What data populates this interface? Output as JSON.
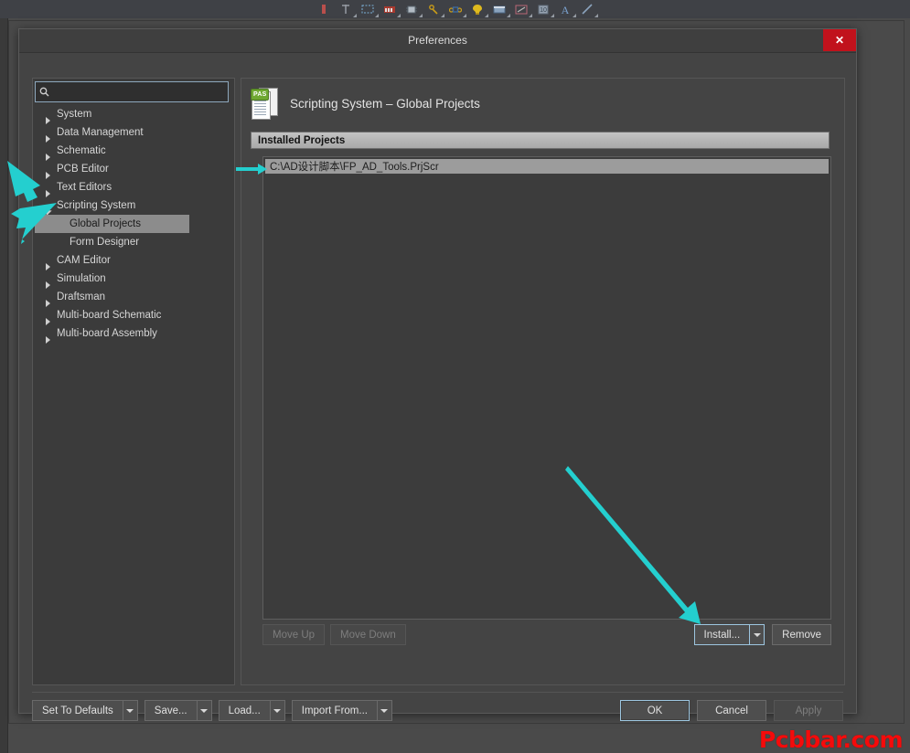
{
  "app": {
    "toolbar_icons": [
      "component-icon",
      "place-wire-icon",
      "rectangle-select-icon",
      "board-icon",
      "chip-icon",
      "tools-icon",
      "net-icon",
      "lamp-icon",
      "panel-icon",
      "draw-icon",
      "image-icon",
      "text-icon",
      "line-icon"
    ]
  },
  "dialog": {
    "title": "Preferences",
    "close_label": "✕"
  },
  "search": {
    "value": "",
    "placeholder": "",
    "icon": "search-icon"
  },
  "sidebar": {
    "items": [
      {
        "label": "System",
        "level": 0,
        "state": "collapsed",
        "selected": false
      },
      {
        "label": "Data Management",
        "level": 0,
        "state": "collapsed",
        "selected": false
      },
      {
        "label": "Schematic",
        "level": 0,
        "state": "collapsed",
        "selected": false
      },
      {
        "label": "PCB Editor",
        "level": 0,
        "state": "collapsed",
        "selected": false
      },
      {
        "label": "Text Editors",
        "level": 0,
        "state": "collapsed",
        "selected": false
      },
      {
        "label": "Scripting System",
        "level": 0,
        "state": "expanded",
        "selected": false
      },
      {
        "label": "Global Projects",
        "level": 1,
        "state": "leaf",
        "selected": true
      },
      {
        "label": "Form Designer",
        "level": 1,
        "state": "leaf",
        "selected": false
      },
      {
        "label": "CAM Editor",
        "level": 0,
        "state": "collapsed",
        "selected": false
      },
      {
        "label": "Simulation",
        "level": 0,
        "state": "collapsed",
        "selected": false
      },
      {
        "label": "Draftsman",
        "level": 0,
        "state": "collapsed",
        "selected": false
      },
      {
        "label": "Multi-board Schematic",
        "level": 0,
        "state": "collapsed",
        "selected": false
      },
      {
        "label": "Multi-board Assembly",
        "level": 0,
        "state": "collapsed",
        "selected": false
      }
    ]
  },
  "page": {
    "icon": "pas-script-document-icon",
    "icon_badge": "PAS",
    "title": "Scripting System – Global Projects",
    "section_title": "Installed Projects",
    "projects": [
      {
        "path": "C:\\AD设计脚本\\FP_AD_Tools.PrjScr",
        "selected": true
      }
    ],
    "actions": {
      "move_up": "Move Up",
      "move_up_disabled": true,
      "move_down": "Move Down",
      "move_down_disabled": true,
      "install": "Install...",
      "install_focused": true,
      "remove": "Remove"
    }
  },
  "footer": {
    "set_to_defaults": "Set To Defaults",
    "save": "Save...",
    "load": "Load...",
    "import_from": "Import From...",
    "ok": "OK",
    "cancel": "Cancel",
    "apply": "Apply",
    "apply_disabled": true
  },
  "annotations": {
    "arrow_color": "#24cfcf",
    "arrows": [
      {
        "name": "arrow-to-scripting-system",
        "target": "Scripting System"
      },
      {
        "name": "arrow-to-global-projects",
        "target": "Global Projects"
      },
      {
        "name": "arrow-to-project-path",
        "target": "C:\\AD设计脚本\\FP_AD_Tools.PrjScr"
      },
      {
        "name": "arrow-to-install-button",
        "target": "Install..."
      }
    ]
  },
  "watermark": {
    "text": "Pcbbar.com",
    "color": "#f50b0b"
  }
}
